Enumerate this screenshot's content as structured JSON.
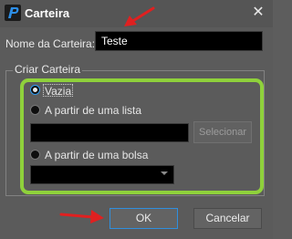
{
  "window": {
    "title": "Carteira",
    "close_glyph": "✕"
  },
  "name_field": {
    "label": "Nome da Carteira:",
    "value": "Teste"
  },
  "group": {
    "title": "Criar Carteira",
    "options": [
      {
        "label": "Vazia",
        "checked": true
      },
      {
        "label": "A partir de uma lista",
        "checked": false
      },
      {
        "label": "A partir de uma bolsa",
        "checked": false
      }
    ],
    "select_button": "Selecionar",
    "list_path_value": "",
    "exchange_value": ""
  },
  "buttons": {
    "ok": "OK",
    "cancel": "Cancelar"
  },
  "colors": {
    "highlight_green": "#8fd13b",
    "arrow_red": "#e02020",
    "focus_blue": "#2d9bf0"
  },
  "icons": {
    "app": "profit-p-logo-icon",
    "arrow": "red-arrow-annotation-icon"
  }
}
